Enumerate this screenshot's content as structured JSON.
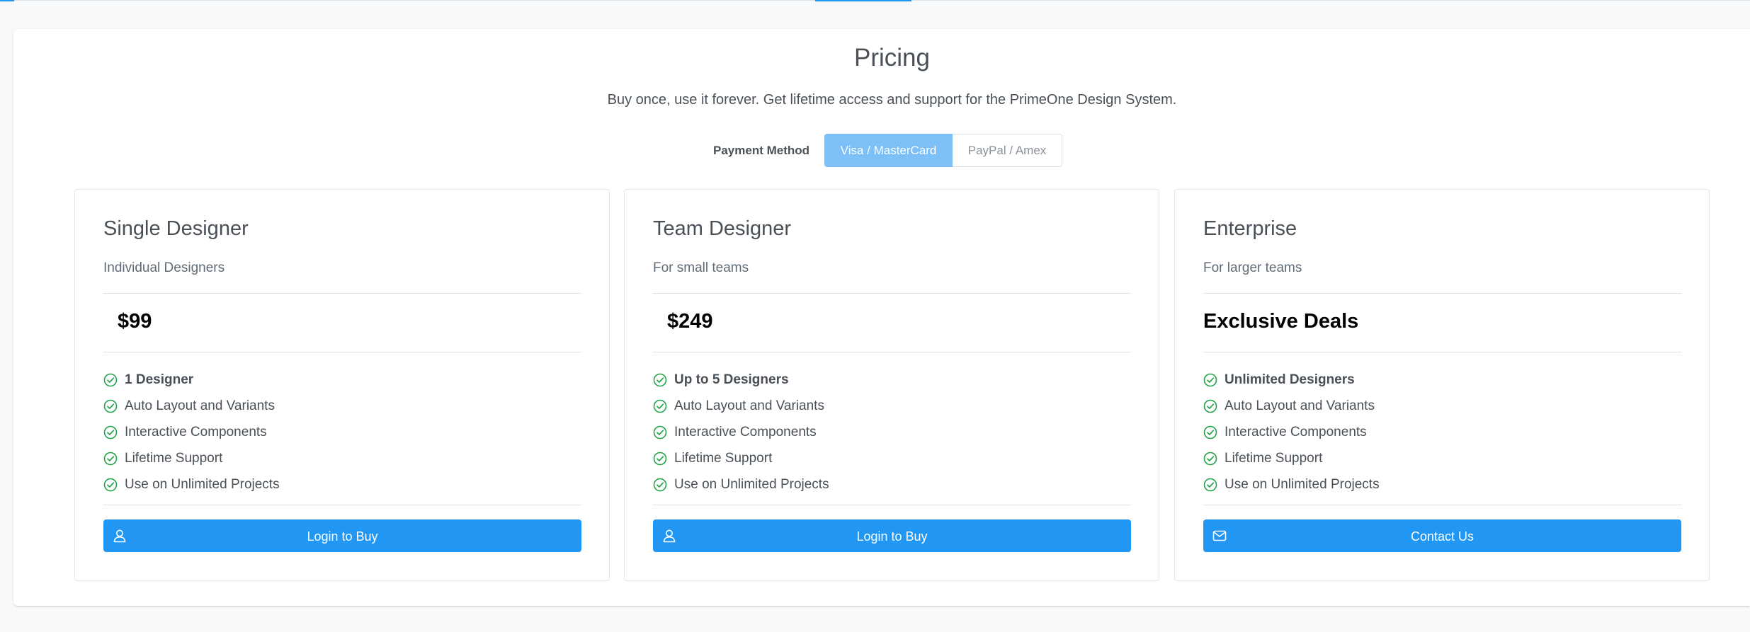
{
  "header": {
    "title": "Pricing",
    "subtitle": "Buy once, use it forever. Get lifetime access and support for the PrimeOne Design System."
  },
  "payment": {
    "label": "Payment Method",
    "options": [
      "Visa / MasterCard",
      "PayPal / Amex"
    ],
    "selected": "Visa / MasterCard"
  },
  "plans": [
    {
      "name": "Single Designer",
      "description": "Individual Designers",
      "price": "$99",
      "features": [
        "1 Designer",
        "Auto Layout and Variants",
        "Interactive Components",
        "Lifetime Support",
        "Use on Unlimited Projects"
      ],
      "button_label": "Login to Buy",
      "button_icon": "user-icon"
    },
    {
      "name": "Team Designer",
      "description": "For small teams",
      "price": "$249",
      "features": [
        "Up to 5 Designers",
        "Auto Layout and Variants",
        "Interactive Components",
        "Lifetime Support",
        "Use on Unlimited Projects"
      ],
      "button_label": "Login to Buy",
      "button_icon": "user-icon"
    },
    {
      "name": "Enterprise",
      "description": "For larger teams",
      "price": "Exclusive Deals",
      "features": [
        "Unlimited Designers",
        "Auto Layout and Variants",
        "Interactive Components",
        "Lifetime Support",
        "Use on Unlimited Projects"
      ],
      "button_label": "Contact Us",
      "button_icon": "envelope-icon"
    }
  ],
  "colors": {
    "primary": "#2196f3",
    "selected_segment": "#7dc0f7",
    "check": "#22a34a"
  }
}
